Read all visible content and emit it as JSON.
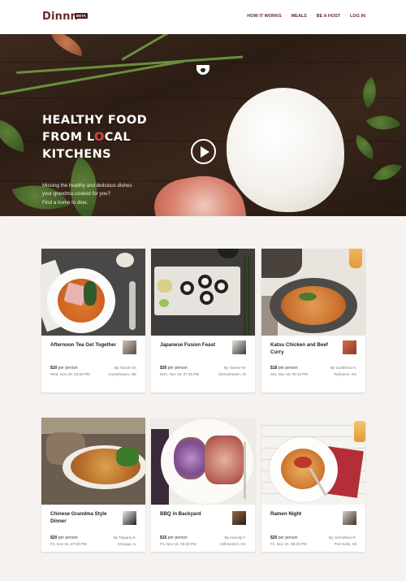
{
  "brand": {
    "logo": "Dinnr.",
    "badge": "BETA"
  },
  "nav": {
    "items": [
      "HOW IT WORKS",
      "MEALS",
      "BE A HOST",
      "LOG IN"
    ],
    "separator": "·"
  },
  "hero": {
    "title_pre": "HEALTHY FOOD\nFROM L",
    "title_o": "O",
    "title_post": "CAL\nKITCHENS",
    "subtitle": "Missing the healthy and delicious dishes\nyour grandma cooked for you?\nFind a home to dine."
  },
  "meals": [
    {
      "title": "Afternoon Tea Get Together",
      "price": "$10",
      "price_unit": "per person",
      "datetime": "Wed, Nov 20, 03:30 PM",
      "host": "By Tanner M.",
      "location": "Koseyhaven, NE"
    },
    {
      "title": "Japanese Fusion Feast",
      "price": "$30",
      "price_unit": "per person",
      "datetime": "Mon, Nov 18, 07:30 PM",
      "host": "By Tanner M.",
      "location": "Vernonhaven, IN"
    },
    {
      "title": "Katsu Chicken and Beef Curry",
      "price": "$18",
      "price_unit": "per person",
      "datetime": "Sat, Nov 16, 05:15 PM",
      "host": "By Guillermo H.",
      "location": "Toyhaven, KS"
    },
    {
      "title": "Chinese Grandma Style\nDinner",
      "price": "$20",
      "price_unit": "per person",
      "datetime": "Fri, Nov 15, 07:00 PM",
      "host": "By Tatyana K.",
      "location": "Chicago, IL"
    },
    {
      "title": "BBQ in Backyard",
      "price": "$15",
      "price_unit": "per person",
      "datetime": "Fri, Nov 15, 08:30 PM",
      "host": "By Aracely T.",
      "location": "Vollmanfort, GA"
    },
    {
      "title": "Ramen Night",
      "price": "$20",
      "price_unit": "per person",
      "datetime": "Fri, Nov 15, 05:30 PM",
      "host": "By Johnathon R.",
      "location": "Port Kelsi, MI"
    }
  ],
  "colors": {
    "brand": "#6b2a2a",
    "accent_o": "#e24545",
    "page_bg": "#f5f2ef"
  }
}
